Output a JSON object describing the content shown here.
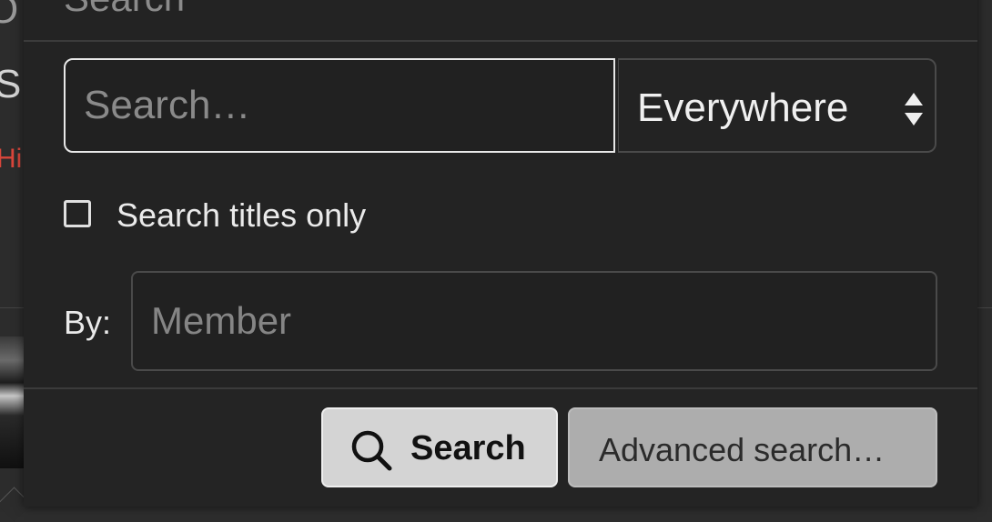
{
  "background": {
    "letters": [
      "O",
      "S",
      "Hi"
    ]
  },
  "menu": {
    "title": "Search",
    "search": {
      "placeholder": "Search…",
      "scope_value": "Everywhere"
    },
    "titles_only": {
      "label": "Search titles only",
      "checked": false
    },
    "by": {
      "label": "By:",
      "placeholder": "Member"
    },
    "buttons": {
      "search_label": "Search",
      "advanced_label": "Advanced search…"
    }
  },
  "colors": {
    "panel_bg": "#232323",
    "input_focus_border": "#e8e8e8",
    "primary_button_bg": "#d4d4d4",
    "secondary_button_bg": "#adadad",
    "accent_red": "#d9463b"
  },
  "icons": {
    "search_button_icon": "search-icon",
    "scope_arrows_icon": "sort-arrows-icon"
  }
}
